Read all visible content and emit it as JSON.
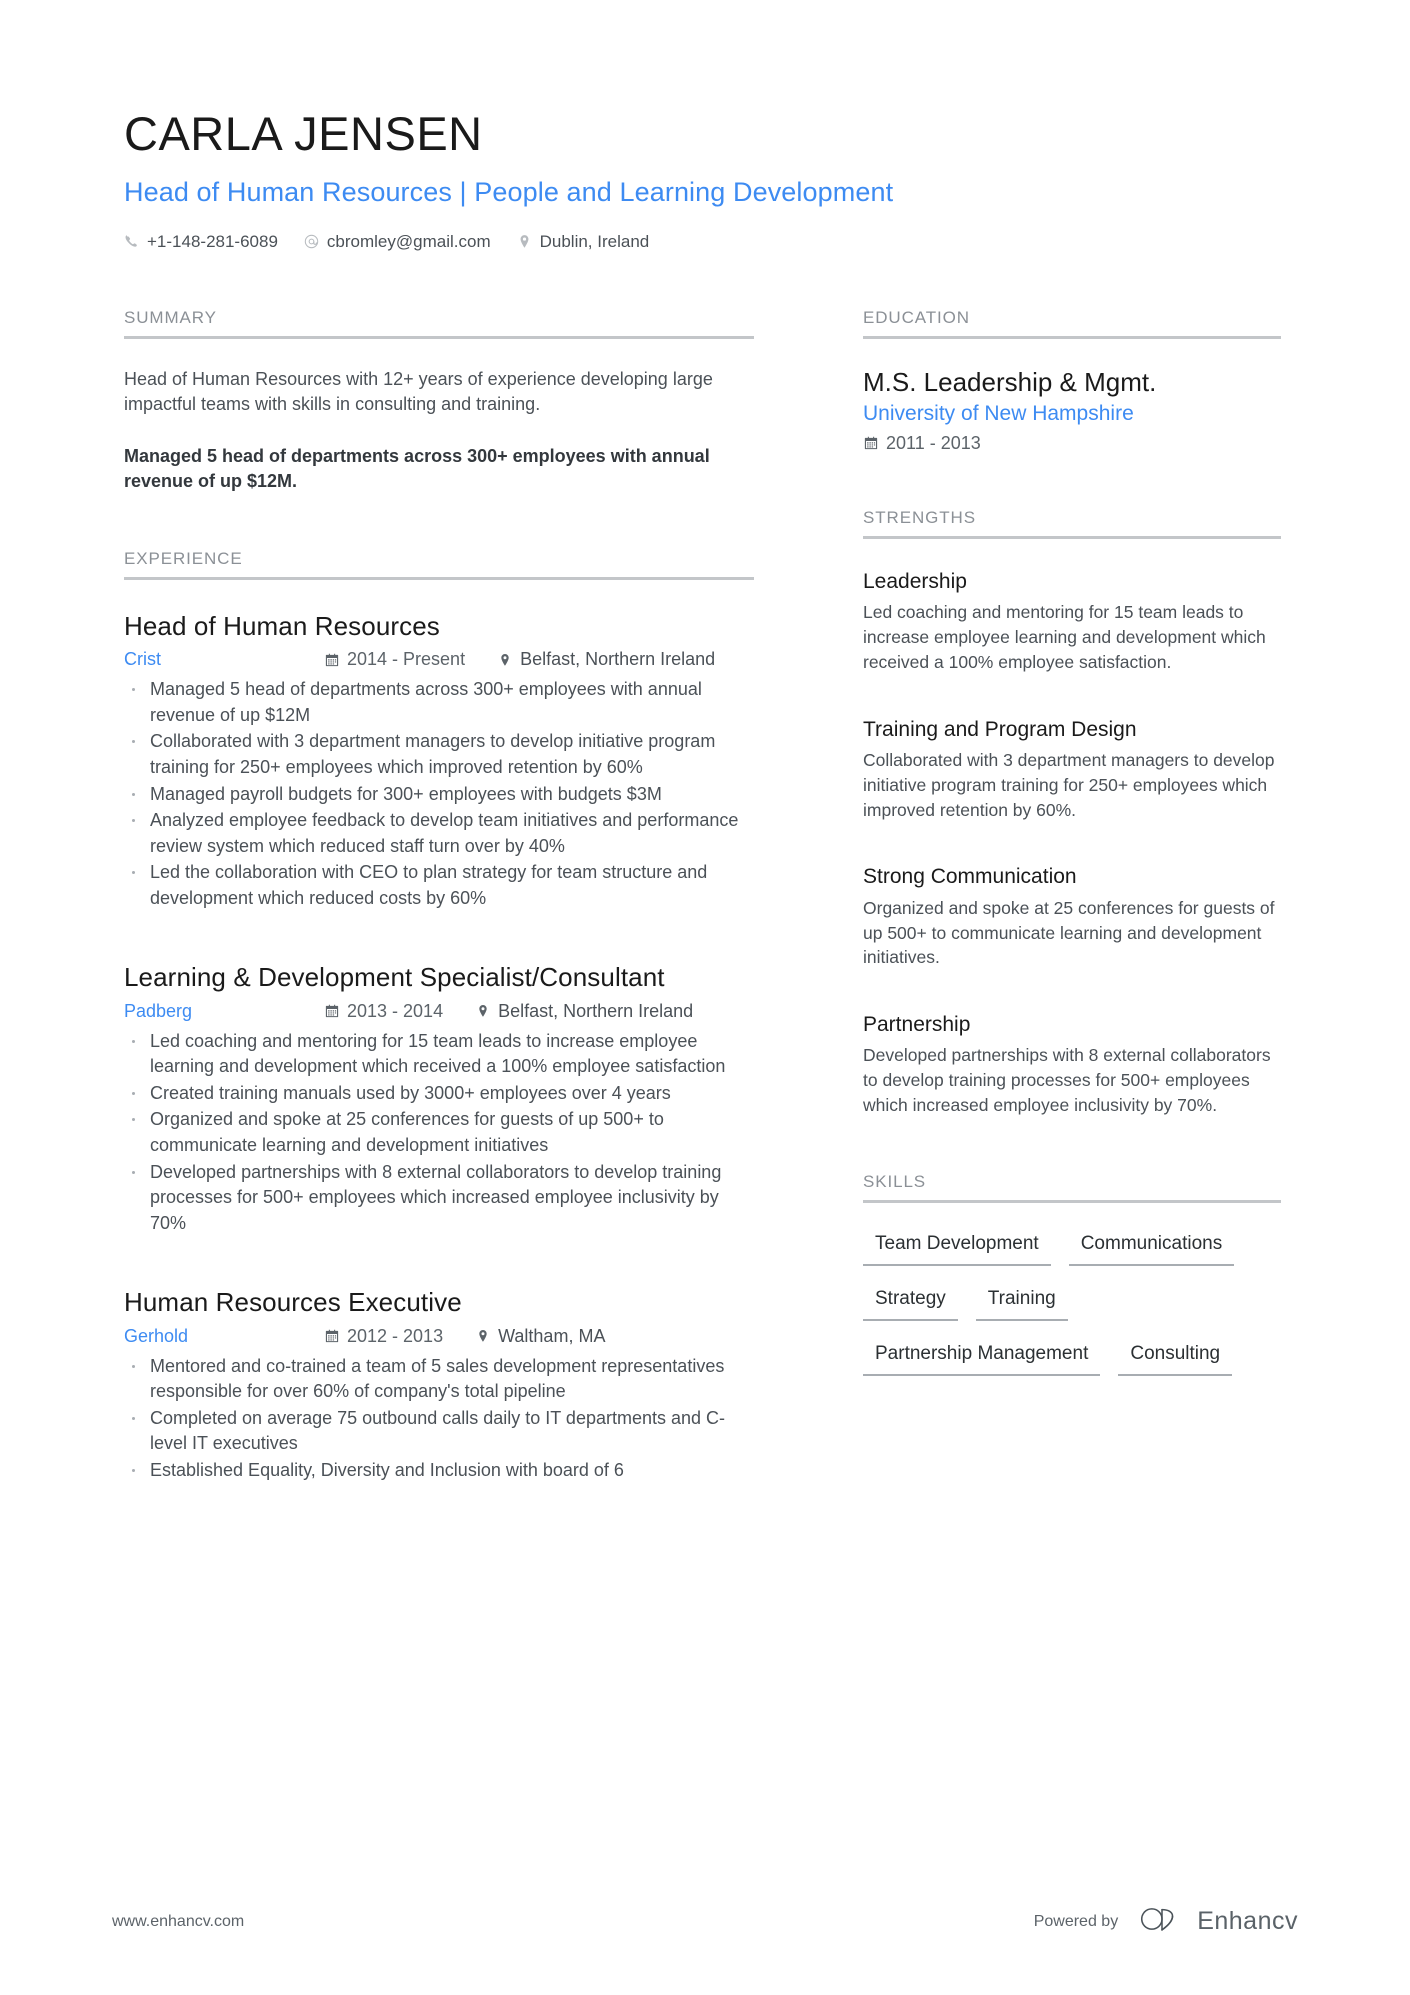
{
  "header": {
    "name": "CARLA JENSEN",
    "headline": "Head of Human Resources | People and Learning Development",
    "contacts": [
      {
        "icon": "phone-icon",
        "value": "+1-148-281-6089"
      },
      {
        "icon": "email-icon",
        "value": "cbromley@gmail.com"
      },
      {
        "icon": "location-icon",
        "value": "Dublin, Ireland"
      }
    ]
  },
  "sections": {
    "summary_title": "SUMMARY",
    "experience_title": "EXPERIENCE",
    "education_title": "EDUCATION",
    "strengths_title": "STRENGTHS",
    "skills_title": "SKILLS"
  },
  "summary": {
    "paragraph": "Head of Human Resources with 12+ years of experience developing large impactful teams with skills in consulting and training.",
    "highlight": "Managed 5 head of departments across 300+ employees with annual revenue of up $12M."
  },
  "experience": [
    {
      "title": "Head of Human Resources",
      "company": "Crist",
      "dates": "2014 - Present",
      "location": "Belfast, Northern Ireland",
      "bullets": [
        "Managed 5 head of departments across 300+ employees with annual revenue of up $12M",
        "Collaborated with 3 department managers to develop initiative program training for 250+ employees which improved retention by 60%",
        "Managed payroll budgets for 300+ employees with budgets $3M",
        "Analyzed employee feedback to develop team initiatives and performance review system which reduced staff turn over by 40%",
        "Led the collaboration with CEO to plan strategy for team structure and development which reduced costs by 60%"
      ]
    },
    {
      "title": "Learning & Development Specialist/Consultant",
      "company": "Padberg",
      "dates": "2013 - 2014",
      "location": "Belfast, Northern Ireland",
      "bullets": [
        "Led coaching and mentoring for 15 team leads to increase employee learning and development which received a 100% employee satisfaction",
        "Created training manuals used by 3000+ employees over 4 years",
        "Organized and spoke at 25 conferences for guests of up 500+ to communicate learning and development initiatives",
        "Developed partnerships with 8 external collaborators to develop training processes for 500+ employees which increased employee inclusivity by 70%"
      ]
    },
    {
      "title": "Human Resources Executive",
      "company": "Gerhold",
      "dates": "2012 - 2013",
      "location": "Waltham, MA",
      "bullets": [
        "Mentored and co-trained a team of 5 sales development representatives responsible for over 60% of company's total pipeline",
        "Completed on average 75 outbound calls daily to IT departments and C-level IT executives",
        "Established Equality, Diversity and Inclusion with board of 6"
      ]
    }
  ],
  "education": [
    {
      "degree": "M.S. Leadership & Mgmt.",
      "school": "University of New Hampshire",
      "dates": "2011 - 2013"
    }
  ],
  "strengths": [
    {
      "name": "Leadership",
      "description": "Led coaching and mentoring for 15 team leads to increase employee learning and development which received a 100% employee satisfaction."
    },
    {
      "name": "Training and Program Design",
      "description": "Collaborated with 3 department managers to develop initiative program training for 250+ employees which improved retention by 60%."
    },
    {
      "name": "Strong Communication",
      "description": "Organized and spoke at 25 conferences for guests of up 500+ to communicate learning and development initiatives."
    },
    {
      "name": "Partnership",
      "description": "Developed partnerships with 8 external collaborators to develop training processes for 500+ employees which increased employee inclusivity by 70%."
    }
  ],
  "skills": [
    "Team Development",
    "Communications",
    "Strategy",
    "Training",
    "Partnership Management",
    "Consulting"
  ],
  "footer": {
    "website": "www.enhancv.com",
    "powered_by": "Powered by",
    "brand": "Enhancv"
  },
  "colors": {
    "accent_blue": "#3d8bf2",
    "text_dark": "#1a1a1a",
    "text_body": "#4b5157",
    "rule_gray": "#c3c6c9"
  }
}
